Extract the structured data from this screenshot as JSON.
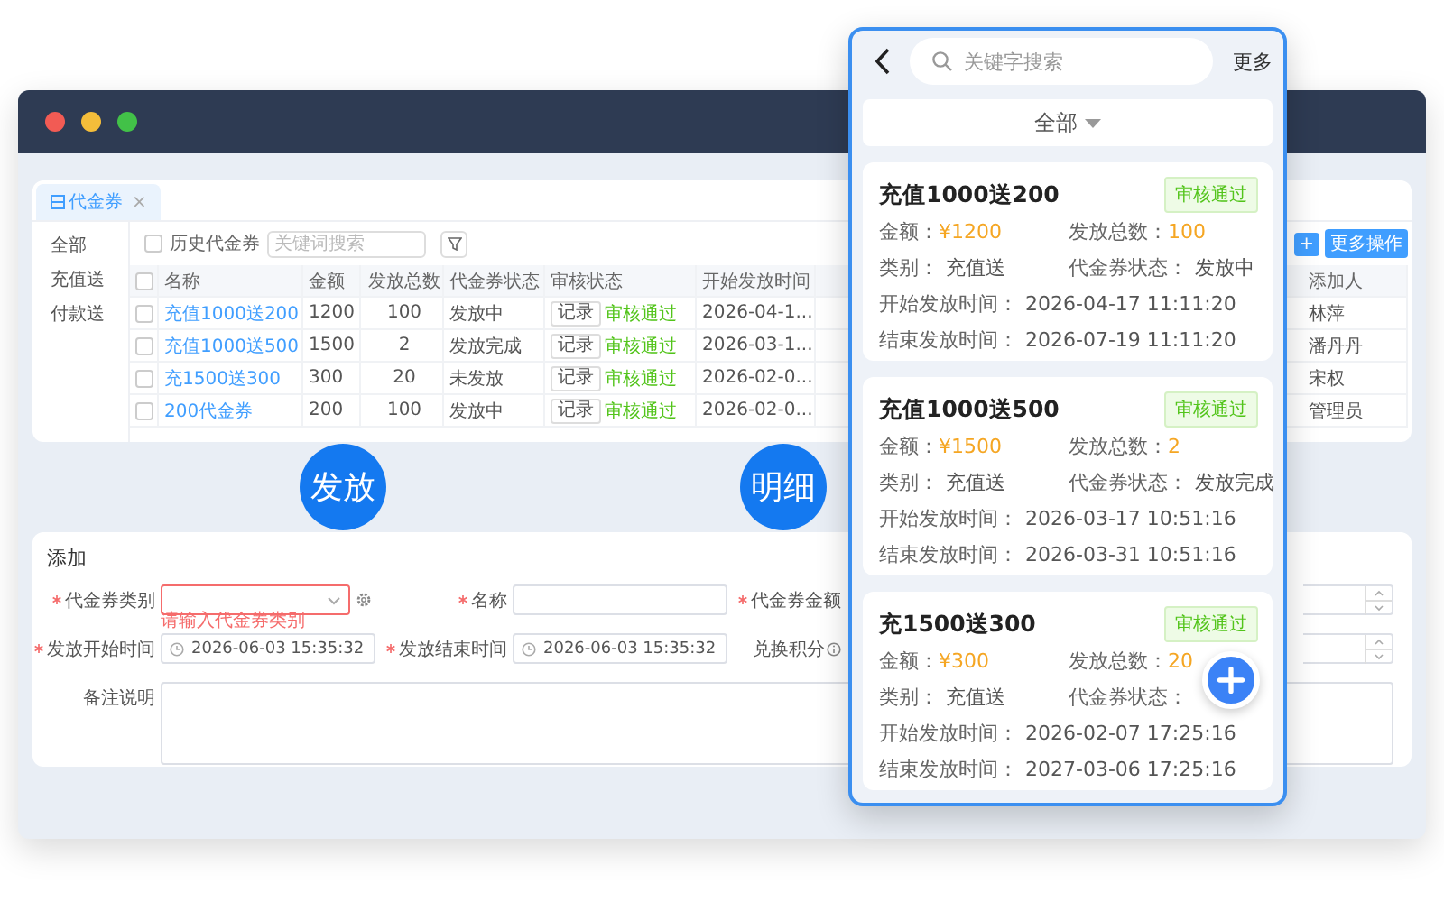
{
  "tab": {
    "label": "代金券",
    "close": "×",
    "selected": true
  },
  "sidebar": {
    "items": [
      {
        "label": "全部",
        "selected": false
      },
      {
        "label": "充值送",
        "selected": false
      },
      {
        "label": "付款送",
        "selected": false
      }
    ]
  },
  "filter": {
    "history": {
      "label": "历史代金券",
      "checked": false
    },
    "search": {
      "placeholder": "关键词搜索"
    }
  },
  "actions": [
    "+",
    "更多操作"
  ],
  "table": {
    "select_all": {
      "checked": false
    },
    "columns": [
      "名称",
      "金额",
      "发放总数",
      "代金券状态",
      "审核状态",
      "开始发放时间",
      "添加人"
    ],
    "rows": [
      {
        "checked": false,
        "name": "充值1000送200",
        "amount": "1200",
        "total": "100",
        "state": "发放中",
        "record": "记录",
        "audit": "审核通过",
        "start": "2026-04-1...",
        "adder": "林萍"
      },
      {
        "checked": false,
        "name": "充值1000送500",
        "amount": "1500",
        "total": "2",
        "state": "发放完成",
        "record": "记录",
        "audit": "审核通过",
        "start": "2026-03-1...",
        "adder": "潘丹丹"
      },
      {
        "checked": false,
        "name": "充1500送300",
        "amount": "300",
        "total": "20",
        "state": "未发放",
        "record": "记录",
        "audit": "审核通过",
        "start": "2026-02-0...",
        "adder": "宋权"
      },
      {
        "checked": false,
        "name": "200代金券",
        "amount": "200",
        "total": "100",
        "state": "发放中",
        "record": "记录",
        "audit": "审核通过",
        "start": "2026-02-0...",
        "adder": "管理员"
      }
    ]
  },
  "form": {
    "title": "添加",
    "fields": [
      {
        "kind": "select",
        "label": "代金券类别",
        "required": true,
        "error": "请输入代金券类别"
      },
      {
        "kind": "text",
        "label": "名称",
        "required": true
      },
      {
        "kind": "number",
        "label": "代金券金额",
        "required": true
      },
      {
        "kind": "datetime",
        "label": "发放开始时间",
        "required": true,
        "value": "2026-06-03 15:35:32"
      },
      {
        "kind": "datetime",
        "label": "发放结束时间",
        "required": true,
        "value": "2026-06-03 15:35:32"
      },
      {
        "kind": "number",
        "label": "兑换积分",
        "required": false,
        "info": true
      },
      {
        "kind": "textarea",
        "label": "备注说明",
        "required": false
      }
    ]
  },
  "callouts": [
    "发放",
    "明细"
  ],
  "phone": {
    "search": {
      "placeholder": "关键字搜索"
    },
    "more": "更多",
    "dropdown": "全部",
    "cards": [
      {
        "title": "充值1000送200",
        "status": "审核通过",
        "fields": [
          {
            "label": "金额：",
            "value": "¥1200",
            "kind": "accent"
          },
          {
            "label": "发放总数：",
            "value": "100",
            "kind": "accent"
          },
          {
            "label": "类别：",
            "value": "充值送",
            "kind": "plain"
          },
          {
            "label": "代金券状态：",
            "value": "发放中",
            "kind": "plain"
          },
          {
            "label": "开始发放时间：",
            "value": "2026-04-17 11:11:20",
            "kind": "wide"
          },
          {
            "label": "结束发放时间：",
            "value": "2026-07-19 11:11:20",
            "kind": "wide"
          }
        ]
      },
      {
        "title": "充值1000送500",
        "status": "审核通过",
        "fields": [
          {
            "label": "金额：",
            "value": "¥1500",
            "kind": "accent"
          },
          {
            "label": "发放总数：",
            "value": "2",
            "kind": "accent"
          },
          {
            "label": "类别：",
            "value": "充值送",
            "kind": "plain"
          },
          {
            "label": "代金券状态：",
            "value": "发放完成",
            "kind": "plain"
          },
          {
            "label": "开始发放时间：",
            "value": "2026-03-17 10:51:16",
            "kind": "wide"
          },
          {
            "label": "结束发放时间：",
            "value": "2026-03-31 10:51:16",
            "kind": "wide"
          }
        ]
      },
      {
        "title": "充1500送300",
        "status": "审核通过",
        "fields": [
          {
            "label": "金额：",
            "value": "¥300",
            "kind": "accent"
          },
          {
            "label": "发放总数：",
            "value": "20",
            "kind": "accent"
          },
          {
            "label": "类别：",
            "value": "充值送",
            "kind": "plain"
          },
          {
            "label": "代金券状态：",
            "kind": "plain"
          },
          {
            "label": "开始发放时间：",
            "value": "2026-02-07 17:25:16",
            "kind": "wide"
          },
          {
            "label": "结束发放时间：",
            "value": "2027-03-06 17:25:16",
            "kind": "wide"
          }
        ]
      }
    ]
  }
}
